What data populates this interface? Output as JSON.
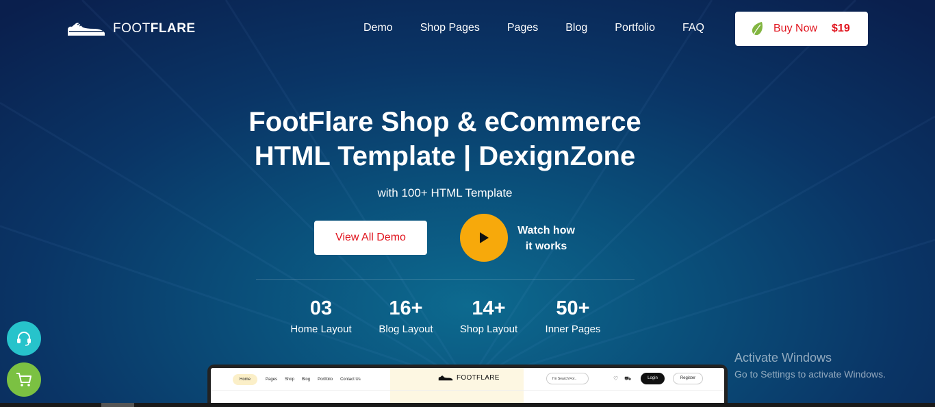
{
  "header": {
    "logo": {
      "light": "FOOT",
      "bold": "FLARE"
    },
    "nav": [
      "Demo",
      "Shop Pages",
      "Pages",
      "Blog",
      "Portfolio",
      "FAQ"
    ],
    "buy": {
      "label": "Buy Now",
      "price": "$19",
      "icon": "envato-leaf-icon"
    }
  },
  "hero": {
    "title_line1": "FootFlare Shop & eCommerce",
    "title_line2": "HTML Template | DexignZone",
    "subtitle": "with 100+ HTML Template",
    "demo_button": "View All Demo",
    "watch_line1": "Watch how",
    "watch_line2": "it works"
  },
  "stats": [
    {
      "num": "03",
      "label": "Home Layout"
    },
    {
      "num": "16+",
      "label": "Blog Layout"
    },
    {
      "num": "14+",
      "label": "Shop Layout"
    },
    {
      "num": "50+",
      "label": "Inner Pages"
    }
  ],
  "floating": {
    "support_icon": "headset-icon",
    "cart_icon": "cart-icon"
  },
  "activate": {
    "title": "Activate Windows",
    "subtitle": "Go to Settings to activate Windows."
  },
  "preview": {
    "nav": [
      "Home",
      "Pages",
      "Shop",
      "Blog",
      "Portfolio",
      "Contact Us"
    ],
    "logo": "FOOTFLARE",
    "search_placeholder": "I'm Search For..",
    "login": "Login",
    "register": "Register"
  },
  "colors": {
    "accent_red": "#e0141e",
    "play_yellow": "#f7a90b",
    "support_teal": "#27c3cb",
    "cart_green": "#7bc142",
    "bg_dark": "#0a1f4d"
  }
}
